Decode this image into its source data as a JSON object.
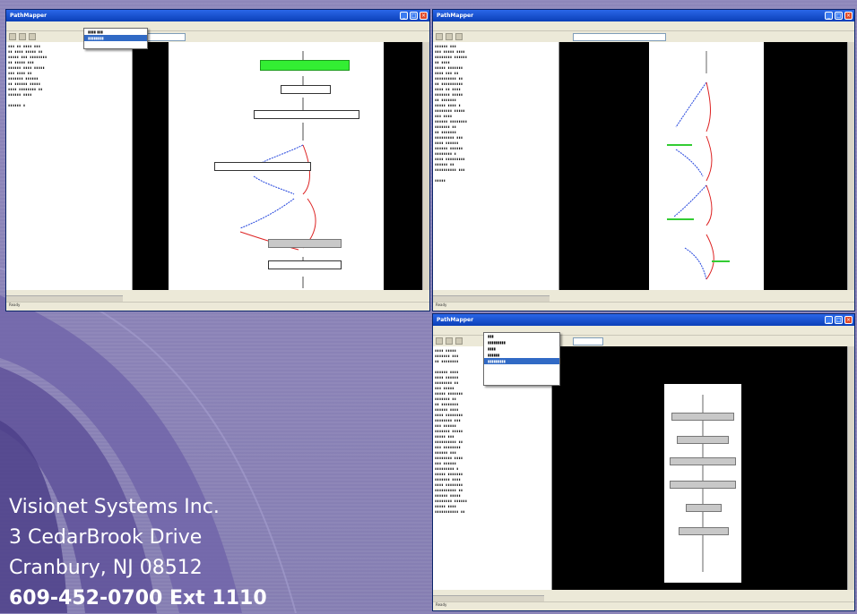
{
  "company": {
    "name": "Visionet Systems Inc.",
    "street": "3 CedarBrook Drive",
    "city": "Cranbury, NJ 08512",
    "phone": "609-452-0700 Ext 1110"
  },
  "windows": [
    {
      "title": "PathMapper",
      "status": "Ready"
    },
    {
      "title": "PathMapper",
      "status": "Ready"
    },
    {
      "title": "PathMapper",
      "status": "Ready"
    }
  ],
  "icons": {
    "minimize": "minimize-icon",
    "maximize": "maximize-icon",
    "close": "close-icon"
  },
  "colors": {
    "accent": "#316ac5",
    "titlebar": "#0b3fb8",
    "highlight_node": "#33ee33",
    "background": "#8b83b8"
  }
}
